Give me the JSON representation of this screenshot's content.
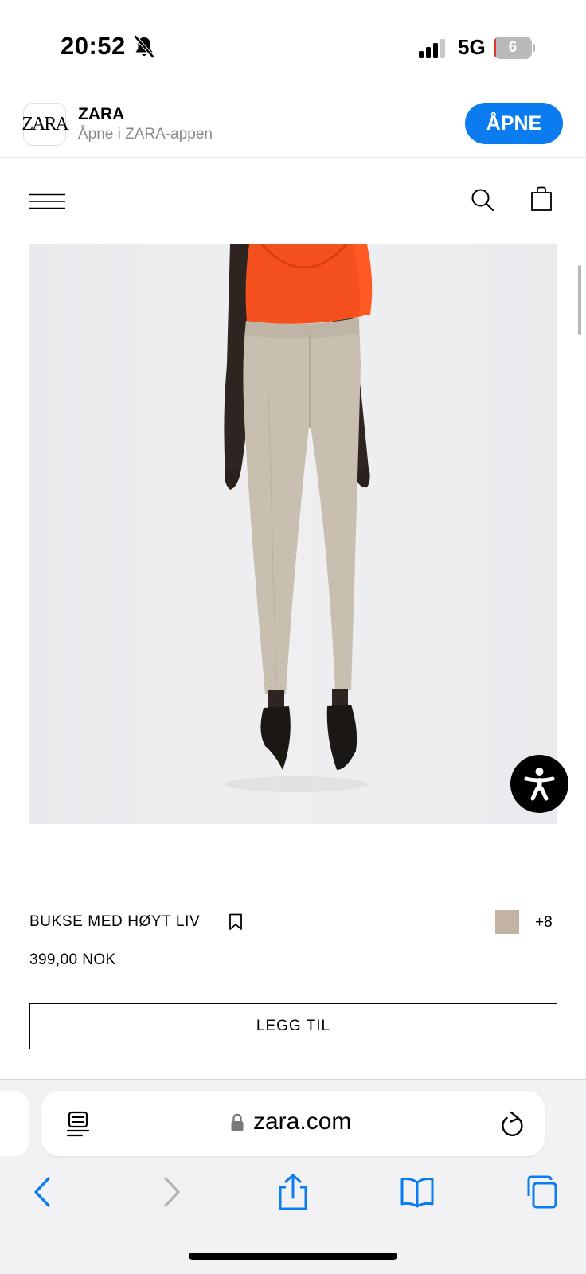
{
  "status_bar": {
    "time": "20:52",
    "network": "5G",
    "battery_level": "6",
    "battery_fraction": 0.06,
    "icons": [
      "bell-muted-icon",
      "cellular-signal-icon",
      "battery-icon"
    ]
  },
  "app_banner": {
    "logo_text": "ZARA",
    "app_name": "ZARA",
    "subtitle": "Åpne i ZARA-appen",
    "open_label": "ÅPNE",
    "accent_color": "#0a7cf0"
  },
  "header": {
    "icons": [
      "menu-icon",
      "search-icon",
      "shopping-bag-icon"
    ]
  },
  "product": {
    "image_icon": "product-photo",
    "name": "BUKSE MED HØYT LIV",
    "price": "399,00 NOK",
    "swatch_color": "#c2b3a2",
    "more_colors": "+8",
    "add_label": "LEGG TIL"
  },
  "browser": {
    "url": "zara.com",
    "icons": [
      "reader-icon",
      "lock-icon",
      "reload-icon",
      "back-icon",
      "forward-icon",
      "share-icon",
      "bookmarks-icon",
      "tabs-icon"
    ],
    "tint_color": "#0a7cf0"
  }
}
